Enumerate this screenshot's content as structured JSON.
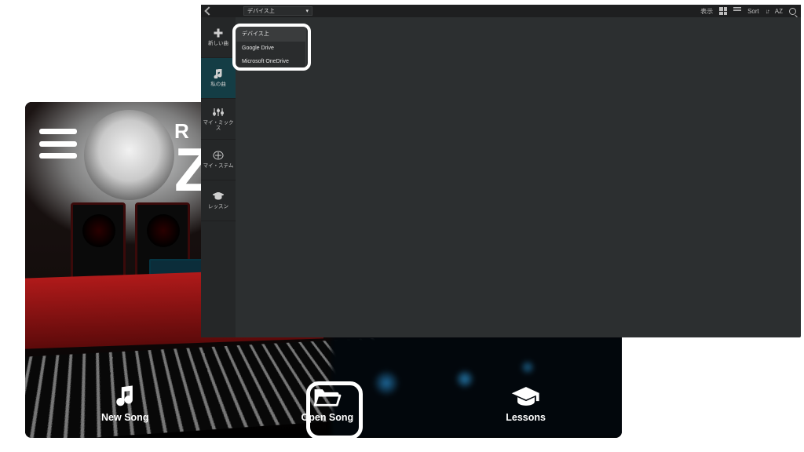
{
  "home": {
    "logo_top": "R",
    "logo_big": "Z",
    "dock": {
      "new_song": "New Song",
      "open_song": "Open Song",
      "lessons": "Lessons"
    }
  },
  "browser": {
    "source_selector_label": "デバイス上",
    "toolbar": {
      "view_label": "表示",
      "sort_label": "Sort",
      "sort_key": "AZ"
    },
    "sidebar": {
      "new_song": "新しい曲",
      "my_songs": "私の曲",
      "my_mixes": "マイ・ミックス",
      "my_stems": "マイ・ステム",
      "lessons": "レッスン"
    },
    "dropdown": {
      "device": "デバイス上",
      "google": "Google Drive",
      "onedrive": "Microsoft OneDrive"
    }
  }
}
